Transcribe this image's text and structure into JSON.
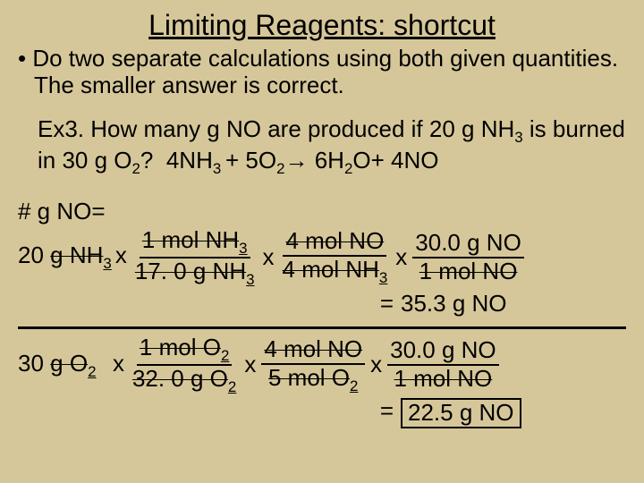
{
  "title": "Limiting Reagents: shortcut",
  "bullet": "Do two separate calculations using both given quantities.  The smaller answer is correct.",
  "example_label": "Ex3.",
  "example_q": "How many g NO are produced if 20 g NH",
  "example_q2": "is burned in 30 g O",
  "example_q3": "?",
  "equation": {
    "a": "4NH",
    "b": "+",
    "c": "5O",
    "d": "→",
    "e": "6H",
    "f": "O+",
    "g": "4NO"
  },
  "calc_header": "# g NO=",
  "chain1": {
    "start_qty": "20",
    "start_unit": "g  NH",
    "f1n": "1 mol NH",
    "f1d": "17. 0 g NH",
    "f2n": "4 mol NO",
    "f2d": "4 mol NH",
    "f3n": "30.0 g NO",
    "f3d": "1 mol NO",
    "result": "35.3 g NO"
  },
  "chain2": {
    "start_qty": "30",
    "start_unit": "g O",
    "f1n": "1 mol O",
    "f1d": "32. 0 g O",
    "f2n": "4 mol NO",
    "f2d": "5 mol O",
    "f3n": "30.0 g NO",
    "f3d": "1 mol NO",
    "result": "22.5 g NO"
  },
  "eq": "=",
  "x": "x"
}
